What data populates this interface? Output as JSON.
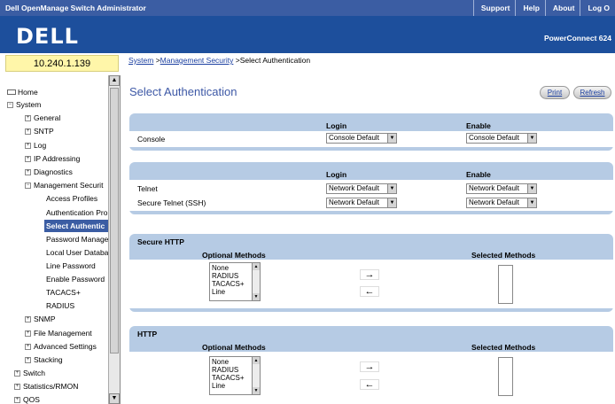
{
  "header": {
    "app_title": "Dell OpenManage Switch Administrator",
    "links": [
      "Support",
      "Help",
      "About",
      "Log O"
    ],
    "logo": "DELL",
    "product": "PowerConnect 624"
  },
  "ip_address": "10.240.1.139",
  "breadcrumb": {
    "part1": "System",
    "sep1": " >",
    "part2": "Management Security",
    "sep2": " >",
    "part3": "Select Authentication"
  },
  "nav": {
    "home": "Home",
    "system": "System",
    "general": "General",
    "sntp": "SNTP",
    "log": "Log",
    "ip_addressing": "IP Addressing",
    "diagnostics": "Diagnostics",
    "mgmt_security": "Management Securit",
    "access_profiles": "Access Profiles",
    "authentication_pro": "Authentication Pro",
    "select_authentic": "Select Authentic",
    "password_manage": "Password Manage",
    "local_user_db": "Local User Databa",
    "line_password": "Line Password",
    "enable_password": "Enable Password",
    "tacacs": "TACACS+",
    "radius": "RADIUS",
    "snmp": "SNMP",
    "file_management": "File Management",
    "advanced_settings": "Advanced Settings",
    "stacking": "Stacking",
    "switch": "Switch",
    "statistics": "Statistics/RMON",
    "qos": "QOS"
  },
  "page": {
    "title": "Select Authentication",
    "print": "Print",
    "refresh": "Refresh"
  },
  "console_panel": {
    "col_login": "Login",
    "col_enable": "Enable",
    "row_label": "Console",
    "login_value": "Console Default",
    "enable_value": "Console Default"
  },
  "telnet_panel": {
    "col_login": "Login",
    "col_enable": "Enable",
    "telnet_label": "Telnet",
    "telnet_login": "Network Default",
    "telnet_enable": "Network Default",
    "ssh_label": "Secure Telnet (SSH)",
    "ssh_login": "Network Default",
    "ssh_enable": "Network Default"
  },
  "secure_http": {
    "title": "Secure HTTP",
    "optional": "Optional Methods",
    "selected": "Selected Methods",
    "opt1": "None",
    "opt2": "RADIUS",
    "opt3": "TACACS+",
    "opt4": "Line"
  },
  "http": {
    "title": "HTTP",
    "optional": "Optional Methods",
    "selected": "Selected Methods",
    "opt1": "None",
    "opt2": "RADIUS",
    "opt3": "TACACS+",
    "opt4": "Line"
  },
  "icons": {
    "add": "right-arrow-icon",
    "remove": "left-arrow-icon"
  },
  "colors": {
    "topbar": "#3b5da3",
    "brand": "#1d4f9c",
    "panel": "#b6cbe4",
    "ip_box": "#fff6a9",
    "title": "#3d58a6"
  }
}
